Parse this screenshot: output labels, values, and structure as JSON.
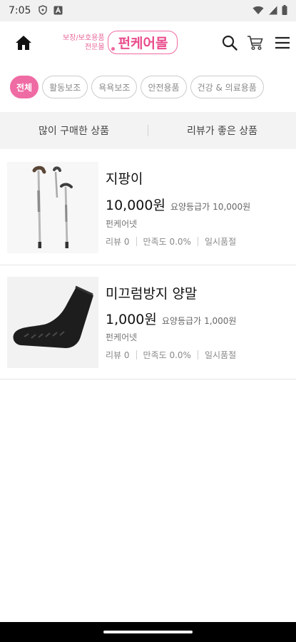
{
  "status_bar": {
    "time": "7:05",
    "icons_left": [
      "shield-icon",
      "a-box-icon"
    ],
    "icons_right": [
      "wifi-icon",
      "signal-icon",
      "battery-icon"
    ]
  },
  "header": {
    "logo_tag_line1": "보장/보호용품",
    "logo_tag_line2": "전문몰",
    "logo_name": "펀케어몰",
    "brand_color": "#ef6ba4"
  },
  "categories": [
    {
      "label": "전체",
      "active": true
    },
    {
      "label": "활동보조",
      "active": false
    },
    {
      "label": "욕욕보조",
      "active": false
    },
    {
      "label": "안전용품",
      "active": false
    },
    {
      "label": "건강 & 의료용품",
      "active": false
    }
  ],
  "sort_tabs": [
    "많이 구매한 상품",
    "리뷰가 좋은 상품"
  ],
  "products": [
    {
      "name": "지팡이",
      "price": "10,000원",
      "care_label": "요양등급가",
      "care_price": "10,000원",
      "seller": "펀케어넷",
      "review": "리뷰 0",
      "satisfaction": "만족도 0.0%",
      "status": "일시품절",
      "image": "walking-canes"
    },
    {
      "name": "미끄럼방지 양말",
      "price": "1,000원",
      "care_label": "요양등급가",
      "care_price": "1,000원",
      "seller": "펀케어넷",
      "review": "리뷰 0",
      "satisfaction": "만족도 0.0%",
      "status": "일시품절",
      "image": "anti-slip-sock"
    }
  ]
}
